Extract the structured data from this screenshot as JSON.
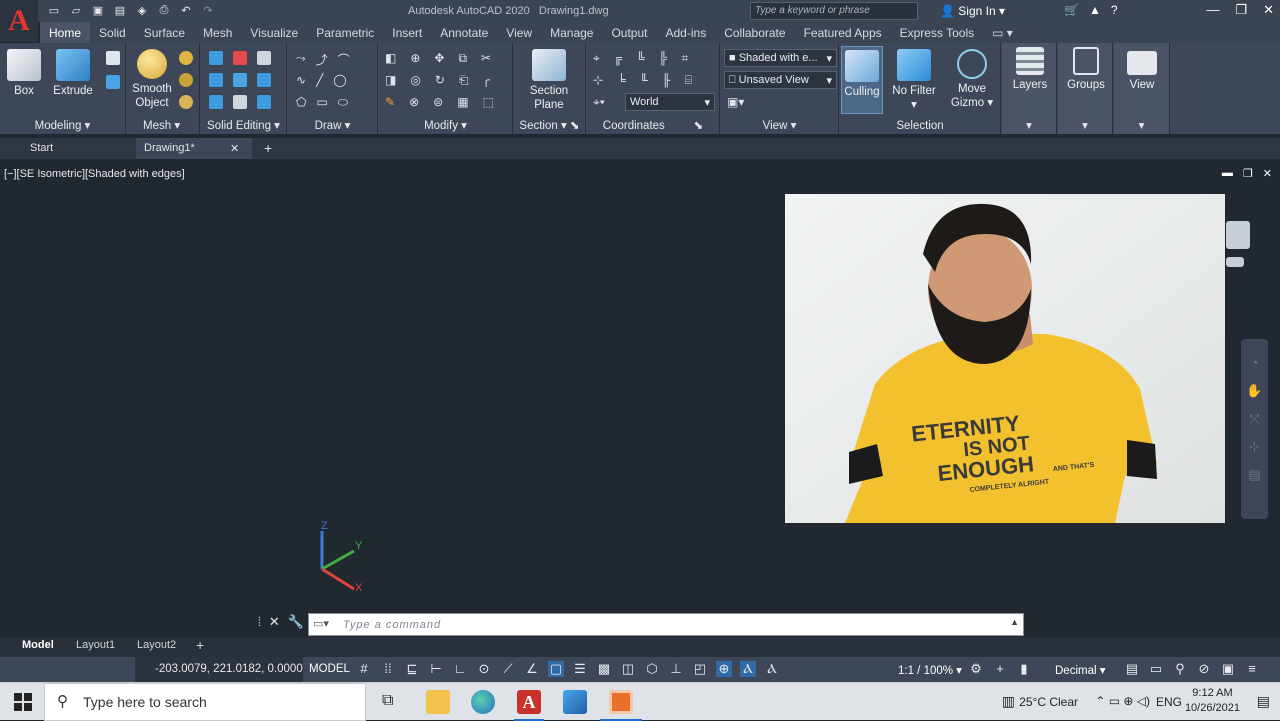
{
  "title_bar": {
    "app_title": "Autodesk AutoCAD 2020",
    "file_name": "Drawing1.dwg",
    "search_placeholder": "Type a keyword or phrase",
    "sign_in": "Sign In",
    "logo_letter": "A"
  },
  "ribbon_tabs": [
    "Home",
    "Solid",
    "Surface",
    "Mesh",
    "Visualize",
    "Parametric",
    "Insert",
    "Annotate",
    "View",
    "Manage",
    "Output",
    "Add-ins",
    "Collaborate",
    "Featured Apps",
    "Express Tools"
  ],
  "active_tab": "Home",
  "panels": {
    "modeling": {
      "label": "Modeling",
      "box": "Box",
      "extrude": "Extrude"
    },
    "mesh": {
      "label": "Mesh",
      "smooth_object_1": "Smooth",
      "smooth_object_2": "Object"
    },
    "solid_editing": {
      "label": "Solid Editing"
    },
    "draw": {
      "label": "Draw"
    },
    "modify": {
      "label": "Modify"
    },
    "section": {
      "label": "Section",
      "section_plane_1": "Section",
      "section_plane_2": "Plane"
    },
    "coordinates": {
      "label": "Coordinates",
      "ucs_value": "World"
    },
    "view": {
      "label": "View",
      "visual_style": "Shaded with e...",
      "named_view": "Unsaved View"
    },
    "selection": {
      "label": "Selection",
      "culling": "Culling",
      "no_filter": "No Filter",
      "move_gizmo_1": "Move",
      "move_gizmo_2": "Gizmo"
    },
    "layers": {
      "label": "Layers"
    },
    "groups": {
      "label": "Groups"
    },
    "view2": {
      "label": "View"
    }
  },
  "doc_tabs": [
    "Start",
    "Drawing1*"
  ],
  "viewport_label": "[−][SE Isometric][Shaded with edges]",
  "webcam_shirt_text": [
    "ETERNITY",
    "IS NOT",
    "ENOUGH",
    "AND THAT'S",
    "COMPLETELY ALRIGHT"
  ],
  "ucs_axes": {
    "x": "X",
    "y": "Y",
    "z": "Z"
  },
  "command_placeholder": "Type a command",
  "layout_tabs": [
    "Model",
    "Layout1",
    "Layout2"
  ],
  "status": {
    "coordinates": "-203.0079, 221.0182, 0.0000",
    "model": "MODEL",
    "scale": "1:1 / 100%",
    "units": "Decimal"
  },
  "taskbar": {
    "search_placeholder": "Type here to search",
    "weather": "25°C  Clear",
    "language": "ENG",
    "time": "9:12 AM",
    "date": "10/26/2021"
  },
  "colors": {
    "ribbon_bg": "#3e4757",
    "viewport_bg": "#212830",
    "accent_red": "#e03a2f",
    "shirt_yellow": "#f3c12e"
  }
}
